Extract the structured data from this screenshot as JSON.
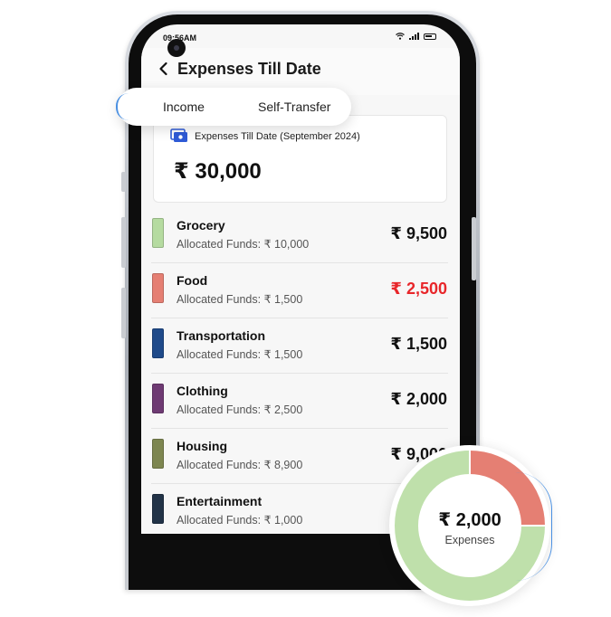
{
  "status_bar": {
    "time": "09:56AM"
  },
  "header": {
    "title": "Expenses Till Date"
  },
  "tabs": [
    {
      "label": "Income"
    },
    {
      "label": "Self-Transfer"
    }
  ],
  "summary": {
    "label": "Expenses Till Date (September 2024)",
    "amount": "₹ 30,000"
  },
  "categories": [
    {
      "name": "Grocery",
      "allocated": "Allocated Funds:  ₹ 10,000",
      "amount": "₹ 9,500",
      "color": "#b5dba0",
      "over_budget": false
    },
    {
      "name": "Food",
      "allocated": "Allocated Funds:  ₹ 1,500",
      "amount": "₹ 2,500",
      "color": "#e57f73",
      "over_budget": true
    },
    {
      "name": "Transportation",
      "allocated": "Allocated Funds:  ₹ 1,500",
      "amount": "₹ 1,500",
      "color": "#1f4a8a",
      "over_budget": false
    },
    {
      "name": "Clothing",
      "allocated": "Allocated Funds:  ₹ 2,500",
      "amount": "₹ 2,000",
      "color": "#6e3a73",
      "over_budget": false
    },
    {
      "name": "Housing",
      "allocated": "Allocated Funds:  ₹ 8,900",
      "amount": "₹ 9,000",
      "color": "#7d8650",
      "over_budget": false
    },
    {
      "name": "Entertainment",
      "allocated": "Allocated Funds:  ₹ 1,000",
      "amount": "",
      "color": "#223347",
      "over_budget": false
    }
  ],
  "donut": {
    "value": "₹ 2,000",
    "caption": "Expenses",
    "segments": [
      {
        "fraction": 0.25,
        "color": "#e57f73"
      },
      {
        "fraction": 0.75,
        "color": "#bfe0ab"
      }
    ]
  },
  "icons": {
    "back": "chevron-left-icon",
    "wallet": "wallet-icon",
    "wifi": "wifi-icon",
    "signal": "signal-icon",
    "battery": "battery-icon"
  }
}
